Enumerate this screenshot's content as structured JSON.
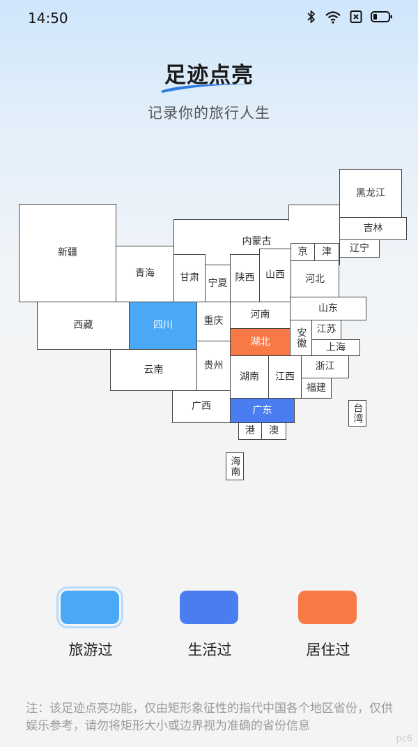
{
  "status": {
    "time": "14:50",
    "icons": [
      "bluetooth-icon",
      "wifi-icon",
      "sim-off-icon",
      "battery-icon"
    ]
  },
  "header": {
    "title": "足迹点亮",
    "subtitle": "记录你的旅行人生"
  },
  "map": {
    "provinces": [
      {
        "id": "heilongjiang",
        "name": "黑龙江",
        "status": "none"
      },
      {
        "id": "jilin",
        "name": "吉林",
        "status": "none"
      },
      {
        "id": "liaoning",
        "name": "辽宁",
        "status": "none"
      },
      {
        "id": "neimenggu",
        "name": "内蒙古",
        "status": "none"
      },
      {
        "id": "beijing",
        "name": "京",
        "status": "none"
      },
      {
        "id": "tianjin",
        "name": "津",
        "status": "none"
      },
      {
        "id": "xinjiang",
        "name": "新疆",
        "status": "none"
      },
      {
        "id": "qinghai",
        "name": "青海",
        "status": "none"
      },
      {
        "id": "gansu",
        "name": "甘肃",
        "status": "none"
      },
      {
        "id": "ningxia",
        "name": "宁夏",
        "status": "none"
      },
      {
        "id": "shaanxi",
        "name": "陕西",
        "status": "none"
      },
      {
        "id": "shanxi",
        "name": "山西",
        "status": "none"
      },
      {
        "id": "hebei",
        "name": "河北",
        "status": "none"
      },
      {
        "id": "xizang",
        "name": "西藏",
        "status": "none"
      },
      {
        "id": "sichuan",
        "name": "四川",
        "status": "travelled"
      },
      {
        "id": "chongqing",
        "name": "重庆",
        "status": "none"
      },
      {
        "id": "henan",
        "name": "河南",
        "status": "none"
      },
      {
        "id": "shandong",
        "name": "山东",
        "status": "none"
      },
      {
        "id": "hubei",
        "name": "湖北",
        "status": "resided"
      },
      {
        "id": "anhui",
        "name": "安徽",
        "status": "none"
      },
      {
        "id": "jiangsu",
        "name": "江苏",
        "status": "none"
      },
      {
        "id": "shanghai",
        "name": "上海",
        "status": "none"
      },
      {
        "id": "yunnan",
        "name": "云南",
        "status": "none"
      },
      {
        "id": "guizhou",
        "name": "贵州",
        "status": "none"
      },
      {
        "id": "hunan",
        "name": "湖南",
        "status": "none"
      },
      {
        "id": "jiangxi",
        "name": "江西",
        "status": "none"
      },
      {
        "id": "zhejiang",
        "name": "浙江",
        "status": "none"
      },
      {
        "id": "fujian",
        "name": "福建",
        "status": "none"
      },
      {
        "id": "guangxi",
        "name": "广西",
        "status": "none"
      },
      {
        "id": "guangdong",
        "name": "广东",
        "status": "lived"
      },
      {
        "id": "taiwan",
        "name": "台湾",
        "status": "none"
      },
      {
        "id": "hongkong",
        "name": "港",
        "status": "none"
      },
      {
        "id": "macau",
        "name": "澳",
        "status": "none"
      },
      {
        "id": "hainan",
        "name": "海南",
        "status": "none"
      }
    ]
  },
  "legend": {
    "items": [
      {
        "id": "travelled",
        "label": "旅游过",
        "color": "#4aa8f8",
        "selected": true
      },
      {
        "id": "lived",
        "label": "生活过",
        "color": "#4a7ef0",
        "selected": false
      },
      {
        "id": "resided",
        "label": "居住过",
        "color": "#f77a46",
        "selected": false
      }
    ]
  },
  "colors": {
    "none": "#ffffff",
    "travelled": "#4aa8f8",
    "lived": "#4a7ef0",
    "resided": "#f77a46",
    "title_underline": "#2f7de0"
  },
  "note": "注：该足迹点亮功能，仅由矩形象征性的指代中国各个地区省份，仅供娱乐参考，请勿将矩形大小或边界视为准确的省份信息",
  "watermark": "pc6"
}
